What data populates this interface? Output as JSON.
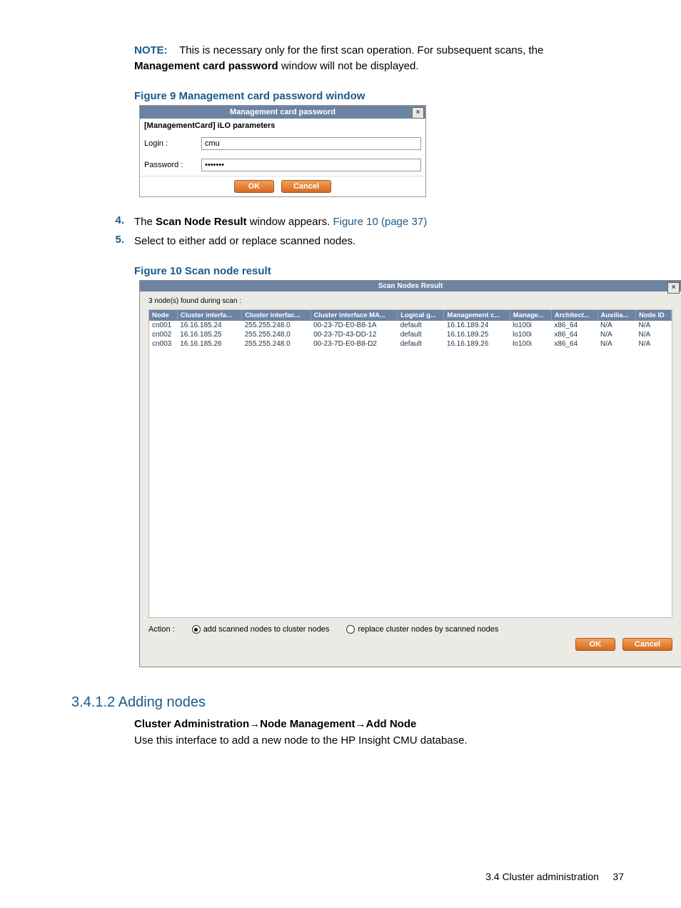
{
  "note": {
    "label": "NOTE:",
    "line1_pre": "This is necessary only for the first scan operation. For subsequent scans, the",
    "line2_bold": "Management card password",
    "line2_rest": " window will not be displayed."
  },
  "figure9": {
    "caption": "Figure 9 Management card password window",
    "title": "Management card password",
    "close": "×",
    "subtitle": "[ManagementCard] iLO parameters",
    "login_label": "Login :",
    "login_value": "cmu",
    "password_label": "Password :",
    "password_value": "•••••••",
    "ok": "OK",
    "cancel": "Cancel"
  },
  "steps": {
    "s4_num": "4.",
    "s4_pre": "The ",
    "s4_bold": "Scan Node Result",
    "s4_mid": " window appears. ",
    "s4_link": "Figure 10 (page 37)",
    "s5_num": "5.",
    "s5_text": "Select to either add or replace scanned nodes."
  },
  "figure10": {
    "caption": "Figure 10 Scan node result",
    "title": "Scan Nodes Result",
    "close": "×",
    "status": "3 node(s) found during scan :",
    "headers": [
      "Node",
      "Cluster interfa...",
      "Cluster interfac...",
      "Cluster interface MA...",
      "Logical g...",
      "Management c...",
      "Manage...",
      "Architect...",
      "Auxilia...",
      "Node ID"
    ],
    "rows": [
      [
        "cn001",
        "16.16.185.24",
        "255.255.248.0",
        "00-23-7D-E0-B8-1A",
        "default",
        "16.16.189.24",
        "lo100i",
        "x86_64",
        "N/A",
        "N/A"
      ],
      [
        "cn002",
        "16.16.185.25",
        "255.255.248.0",
        "00-23-7D-43-DD-12",
        "default",
        "16.16.189.25",
        "lo100i",
        "x86_64",
        "N/A",
        "N/A"
      ],
      [
        "cn003",
        "16.16.185.26",
        "255.255.248.0",
        "00-23-7D-E0-B8-D2",
        "default",
        "16.16.189.26",
        "lo100i",
        "x86_64",
        "N/A",
        "N/A"
      ]
    ],
    "action_label": "Action :",
    "radio_add": "add scanned nodes to cluster nodes",
    "radio_replace": "replace cluster nodes by scanned nodes",
    "ok": "OK",
    "cancel": "Cancel"
  },
  "section": {
    "heading": "3.4.1.2 Adding nodes",
    "crumb1": "Cluster Administration",
    "sep": "→",
    "crumb2": "Node Management",
    "crumb3": "Add Node",
    "para": "Use this interface to add a new node to the HP Insight CMU database."
  },
  "footer": {
    "left": "3.4 Cluster administration",
    "page": "37"
  }
}
